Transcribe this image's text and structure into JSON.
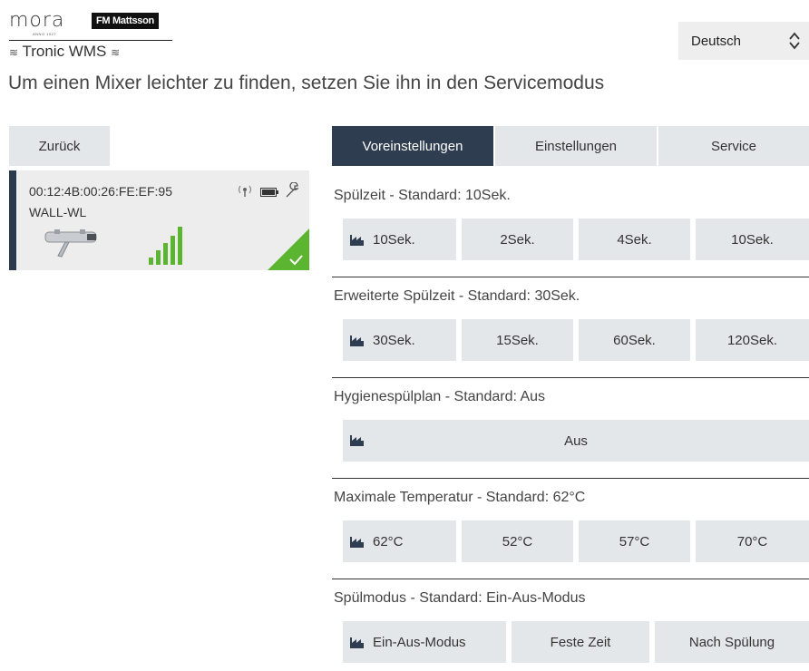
{
  "brand": {
    "mora": "mora",
    "anno": "ANNO 1927",
    "fm": "FM Mattsson",
    "product": "Tronic WMS"
  },
  "language": {
    "selected": "Deutsch"
  },
  "hint": "Um einen Mixer leichter zu finden, setzen Sie ihn in den Servicemodus",
  "back_label": "Zurück",
  "device": {
    "mac": "00:12:4B:00:26:FE:EF:95",
    "name": "WALL-WL",
    "icons": [
      "radio-signal-icon",
      "battery-icon",
      "wrench-icon"
    ],
    "signal_bars": 5,
    "status_icon": "check-icon",
    "colors": {
      "accent": "#2b3a4b",
      "signal": "#5cb531",
      "ok": "#5cb531"
    }
  },
  "tabs": [
    {
      "label": "Voreinstellungen",
      "active": true
    },
    {
      "label": "Einstellungen",
      "active": false
    },
    {
      "label": "Service",
      "active": false
    }
  ],
  "sections": [
    {
      "title": "Spülzeit - Standard: 10Sek.",
      "options": [
        "10Sek.",
        "2Sek.",
        "4Sek.",
        "10Sek."
      ]
    },
    {
      "title": "Erweiterte Spülzeit - Standard: 30Sek.",
      "options": [
        "30Sek.",
        "15Sek.",
        "60Sek.",
        "120Sek."
      ]
    },
    {
      "title": "Hygienespülplan - Standard: Aus",
      "options": [
        "Aus"
      ]
    },
    {
      "title": "Maximale Temperatur - Standard: 62°C",
      "options": [
        "62°C",
        "52°C",
        "57°C",
        "70°C"
      ]
    },
    {
      "title": "Spülmodus - Standard: Ein-Aus-Modus",
      "options": [
        "Ein-Aus-Modus",
        "Feste Zeit",
        "Nach Spülung"
      ]
    }
  ],
  "colors": {
    "tab_active": "#2e3d50",
    "button_bg": "#e4e7e9"
  }
}
